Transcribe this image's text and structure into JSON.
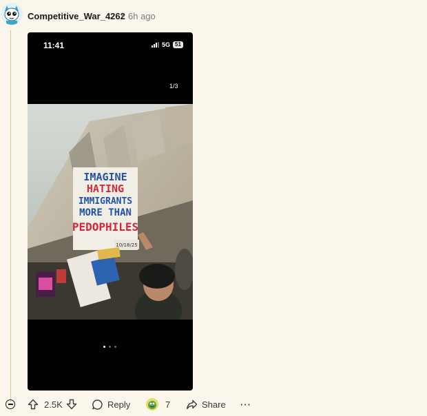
{
  "comment": {
    "username": "Competitive_War_4262",
    "separator": "•",
    "time_ago": "6h ago"
  },
  "media": {
    "status_time": "11:41",
    "network": "5G",
    "battery": "51",
    "counter": "1/3",
    "sign_text": [
      "IMAGINE",
      "HATING",
      "IMMIGRANTS",
      "MORE THAN",
      "PEDOPHILES"
    ],
    "sign_date": "10/18/25"
  },
  "actions": {
    "score": "2.5K",
    "reply_label": "Reply",
    "award_count": "7",
    "share_label": "Share",
    "more_label": "···"
  }
}
